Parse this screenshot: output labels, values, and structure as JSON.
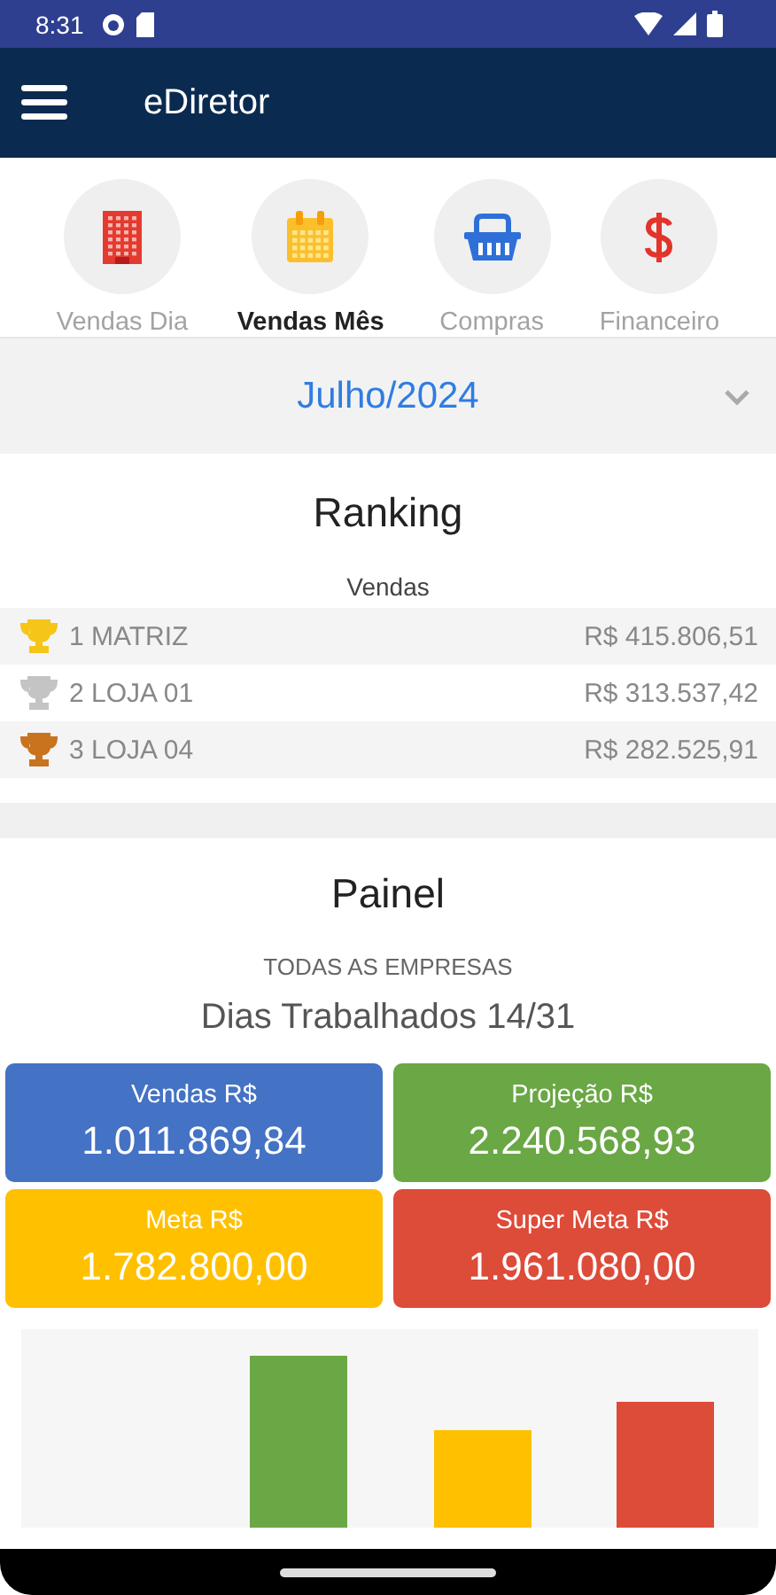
{
  "status_bar": {
    "time": "8:31"
  },
  "app_bar": {
    "title": "eDiretor"
  },
  "nav": [
    {
      "label": "Vendas Dia",
      "kind": "building",
      "selected": false
    },
    {
      "label": "Vendas Mês",
      "kind": "calendar",
      "selected": true
    },
    {
      "label": "Compras",
      "kind": "basket",
      "selected": false
    },
    {
      "label": "Financeiro",
      "kind": "dollar",
      "selected": false
    }
  ],
  "month_selector": {
    "value": "Julho/2024"
  },
  "ranking": {
    "title": "Ranking",
    "subtitle": "Vendas",
    "rows": [
      {
        "name": "1 MATRIZ",
        "value": "R$ 415.806,51",
        "color": "#f5c518"
      },
      {
        "name": "2 LOJA 01",
        "value": "R$ 313.537,42",
        "color": "#c4c4c4"
      },
      {
        "name": "3 LOJA 04",
        "value": "R$ 282.525,91",
        "color": "#c8731e"
      }
    ]
  },
  "painel": {
    "title": "Painel",
    "scope": "TODAS AS EMPRESAS",
    "days": "Dias Trabalhados 14/31",
    "cards": [
      {
        "label": "Vendas R$",
        "value": "1.011.869,84",
        "color": "#4472c4"
      },
      {
        "label": "Projeção R$",
        "value": "2.240.568,93",
        "color": "#6aa745"
      },
      {
        "label": "Meta R$",
        "value": "1.782.800,00",
        "color": "#ffc000"
      },
      {
        "label": "Super Meta R$",
        "value": "1.961.080,00",
        "color": "#dd4b39"
      }
    ]
  }
}
